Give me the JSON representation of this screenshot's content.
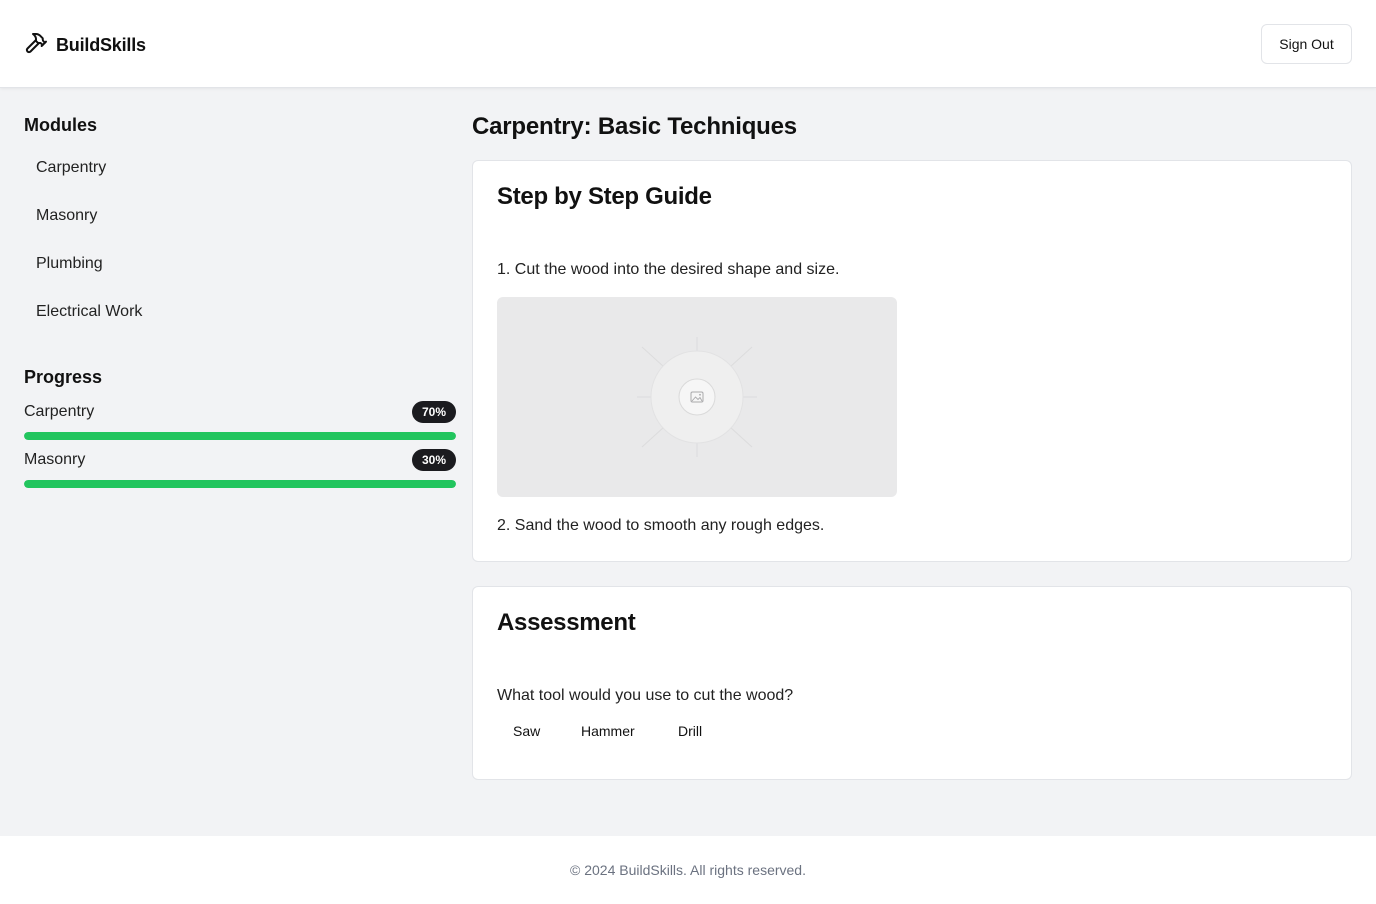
{
  "header": {
    "brand": "BuildSkills",
    "brand_icon": "hammer-icon",
    "signout_label": "Sign Out"
  },
  "sidebar": {
    "modules_heading": "Modules",
    "modules": [
      {
        "label": "Carpentry"
      },
      {
        "label": "Masonry"
      },
      {
        "label": "Plumbing"
      },
      {
        "label": "Electrical Work"
      }
    ],
    "progress_heading": "Progress",
    "progress": [
      {
        "label": "Carpentry",
        "percent_text": "70%",
        "value": 70
      },
      {
        "label": "Masonry",
        "percent_text": "30%",
        "value": 30
      }
    ]
  },
  "main": {
    "title": "Carpentry: Basic Techniques",
    "guide": {
      "heading": "Step by Step Guide",
      "steps": [
        "1. Cut the wood into the desired shape and size.",
        "2. Sand the wood to smooth any rough edges."
      ],
      "image_icon": "image-placeholder-icon"
    },
    "assessment": {
      "heading": "Assessment",
      "question": "What tool would you use to cut the wood?",
      "answers": [
        "Saw",
        "Hammer",
        "Drill"
      ]
    }
  },
  "footer": {
    "text": "© 2024 BuildSkills. All rights reserved."
  },
  "colors": {
    "accent_green": "#22c55e",
    "badge_dark": "#1b1b1f",
    "page_bg": "#f2f3f5"
  }
}
